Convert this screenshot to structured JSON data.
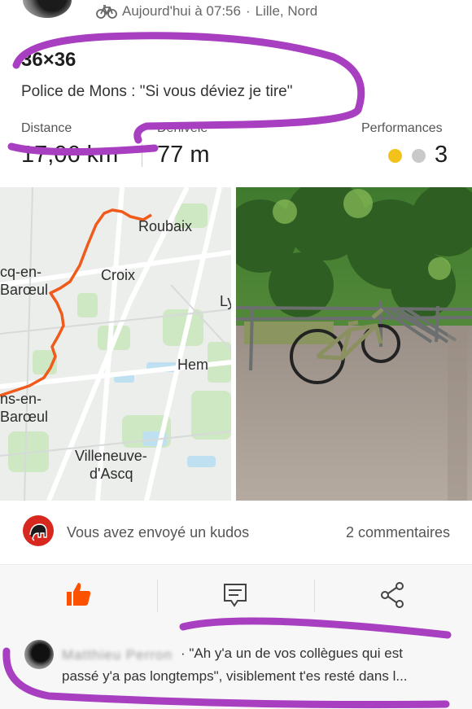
{
  "header": {
    "timestamp": "Aujourd'hui à 07:56",
    "separator": "·",
    "location": "Lille, Nord",
    "activity_icon": "bike-icon"
  },
  "activity": {
    "title": "36×36",
    "description": "Police de Mons : \"Si vous déviez je tire\""
  },
  "stats": {
    "distance_label": "Distance",
    "distance_value": "17,06 km",
    "elevation_label": "Dénivelé",
    "elevation_value": "77 m",
    "performances_label": "Performances",
    "performances_value": "3",
    "medal_colors": [
      "#f2c21b",
      "#c9c9c9"
    ]
  },
  "map": {
    "places": [
      "Roubaix",
      "Croix",
      "Hem",
      "Villeneuve-",
      "d'Ascq",
      "cq-en-",
      "Barœul",
      "ns-en-",
      "Barœul",
      "Ly"
    ],
    "route_color": "#f05a1a"
  },
  "social": {
    "kudos_text": "Vous avez envoyé un kudos",
    "comments_text": "2 commentaires",
    "club_icon": "mammoth-icon"
  },
  "actions": {
    "kudos_icon": "thumbs-up-icon",
    "comment_icon": "comment-icon",
    "share_icon": "share-icon",
    "kudos_color": "#fc5200"
  },
  "comment": {
    "author": "Matthieu Perron",
    "text_line1": "· \"Ah y'a un de vos collègues qui est",
    "text_line2": "passé y'a pas longtemps\", visiblement t'es resté dans l..."
  },
  "annotation_color": "#a83fc0"
}
